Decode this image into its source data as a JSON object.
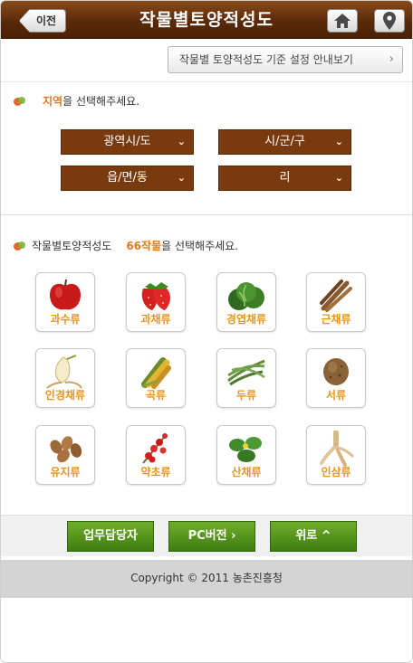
{
  "header": {
    "back_label": "이전",
    "title": "작물별토양적성도",
    "home_icon": "home-icon",
    "location_icon": "map-pin-icon"
  },
  "guide": {
    "label": "작물별 토양적성도 기준 설정 안내보기",
    "arrow": "›"
  },
  "region": {
    "prompt_highlight": "지역",
    "prompt_rest": "을 선택해주세요.",
    "selects": [
      {
        "label": "광역시/도"
      },
      {
        "label": "시/군/구"
      },
      {
        "label": "읍/면/동"
      },
      {
        "label": "리"
      }
    ]
  },
  "crops": {
    "prompt_prefix": "작물별토양적성도",
    "prompt_highlight": "66작물",
    "prompt_rest": "을 선택해주세요.",
    "items": [
      {
        "label": "과수류",
        "icon": "apple-icon"
      },
      {
        "label": "과채류",
        "icon": "strawberry-icon"
      },
      {
        "label": "경엽채류",
        "icon": "cabbage-icon"
      },
      {
        "label": "근채류",
        "icon": "burdock-root-icon"
      },
      {
        "label": "인경채류",
        "icon": "onion-icon"
      },
      {
        "label": "곡류",
        "icon": "corn-icon"
      },
      {
        "label": "두류",
        "icon": "bean-pods-icon"
      },
      {
        "label": "서류",
        "icon": "potato-icon"
      },
      {
        "label": "유지류",
        "icon": "peanut-icon"
      },
      {
        "label": "약초류",
        "icon": "red-berries-icon"
      },
      {
        "label": "산채류",
        "icon": "wild-greens-icon"
      },
      {
        "label": "인삼류",
        "icon": "ginseng-icon"
      }
    ]
  },
  "bottom_buttons": {
    "staff": "업무담당자",
    "pc": "PC버전 ›",
    "top": "위로 ^"
  },
  "footer": {
    "copyright": "Copyright © 2011 농촌진흥청"
  },
  "colors": {
    "header_brown": "#5a2a08",
    "select_brown": "#7a3a10",
    "highlight_orange": "#e8791b",
    "button_green": "#4f8f1a"
  }
}
